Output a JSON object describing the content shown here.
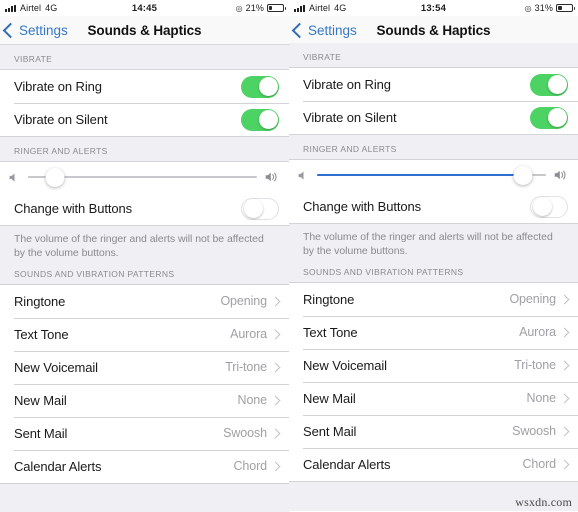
{
  "panels": [
    {
      "status": {
        "carrier": "Airtel",
        "network": "4G",
        "time": "14:45",
        "location_icon": "location-arrow-icon",
        "battery_pct": "21%",
        "battery_level": 21
      },
      "nav": {
        "back_label": "Settings",
        "title": "Sounds & Haptics"
      },
      "vibrate": {
        "header": "VIBRATE",
        "rows": [
          {
            "label": "Vibrate on Ring",
            "state": "on"
          },
          {
            "label": "Vibrate on Silent",
            "state": "on"
          }
        ]
      },
      "ringer": {
        "header": "RINGER AND ALERTS",
        "slider_value": 12,
        "slider_fill_color": "#c7c7cc",
        "change_with_buttons_label": "Change with Buttons",
        "change_with_buttons_state": "off",
        "footnote": "The volume of the ringer and alerts will not be affected by the volume buttons."
      },
      "sounds": {
        "header": "SOUNDS AND VIBRATION PATTERNS",
        "rows": [
          {
            "label": "Ringtone",
            "value": "Opening"
          },
          {
            "label": "Text Tone",
            "value": "Aurora"
          },
          {
            "label": "New Voicemail",
            "value": "Tri-tone"
          },
          {
            "label": "New Mail",
            "value": "None"
          },
          {
            "label": "Sent Mail",
            "value": "Swoosh"
          },
          {
            "label": "Calendar Alerts",
            "value": "Chord"
          }
        ]
      }
    },
    {
      "status": {
        "carrier": "Airtel",
        "network": "4G",
        "time": "13:54",
        "location_icon": "location-arrow-icon",
        "battery_pct": "31%",
        "battery_level": 31
      },
      "nav": {
        "back_label": "Settings",
        "title": "Sounds & Haptics"
      },
      "vibrate": {
        "header": "VIBRATE",
        "rows": [
          {
            "label": "Vibrate on Ring",
            "state": "on"
          },
          {
            "label": "Vibrate on Silent",
            "state": "on"
          }
        ]
      },
      "ringer": {
        "header": "RINGER AND ALERTS",
        "slider_value": 90,
        "slider_fill_color": "#2f6fd0",
        "change_with_buttons_label": "Change with Buttons",
        "change_with_buttons_state": "off",
        "footnote": "The volume of the ringer and alerts will not be affected by the volume buttons."
      },
      "sounds": {
        "header": "SOUNDS AND VIBRATION PATTERNS",
        "rows": [
          {
            "label": "Ringtone",
            "value": "Opening"
          },
          {
            "label": "Text Tone",
            "value": "Aurora"
          },
          {
            "label": "New Voicemail",
            "value": "Tri-tone"
          },
          {
            "label": "New Mail",
            "value": "None"
          },
          {
            "label": "Sent Mail",
            "value": "Swoosh"
          },
          {
            "label": "Calendar Alerts",
            "value": "Chord"
          }
        ]
      }
    }
  ],
  "watermark": "wsxdn.com",
  "colors": {
    "toggle_on": "#4cd363",
    "slider_active": "#2f6fd0",
    "tint": "#3478c6",
    "group_bg": "#efeff4"
  }
}
